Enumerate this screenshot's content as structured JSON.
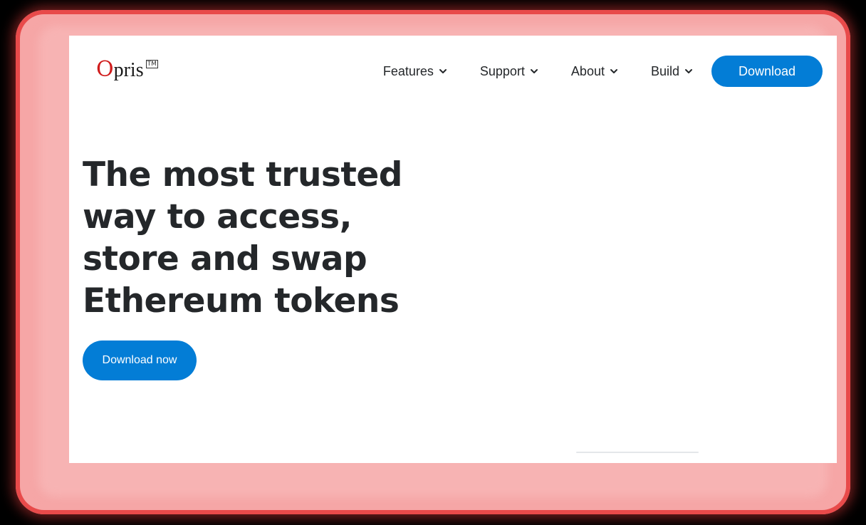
{
  "brand": {
    "logo_initial": "O",
    "logo_rest": "pris",
    "trademark": "TM",
    "accent_color": "#d01c1c"
  },
  "nav": {
    "items": [
      {
        "label": "Features",
        "icon": "chevron-down-icon"
      },
      {
        "label": "Support",
        "icon": "chevron-down-icon"
      },
      {
        "label": "About",
        "icon": "chevron-down-icon"
      },
      {
        "label": "Build",
        "icon": "chevron-down-icon"
      }
    ],
    "download_label": "Download"
  },
  "hero": {
    "title_lines": [
      "The most trusted",
      "way to access,",
      "store and swap",
      "Ethereum tokens"
    ],
    "cta_label": "Download now"
  },
  "colors": {
    "primary": "#037dd6",
    "text": "#24272a",
    "glow": "#e84a4a"
  }
}
